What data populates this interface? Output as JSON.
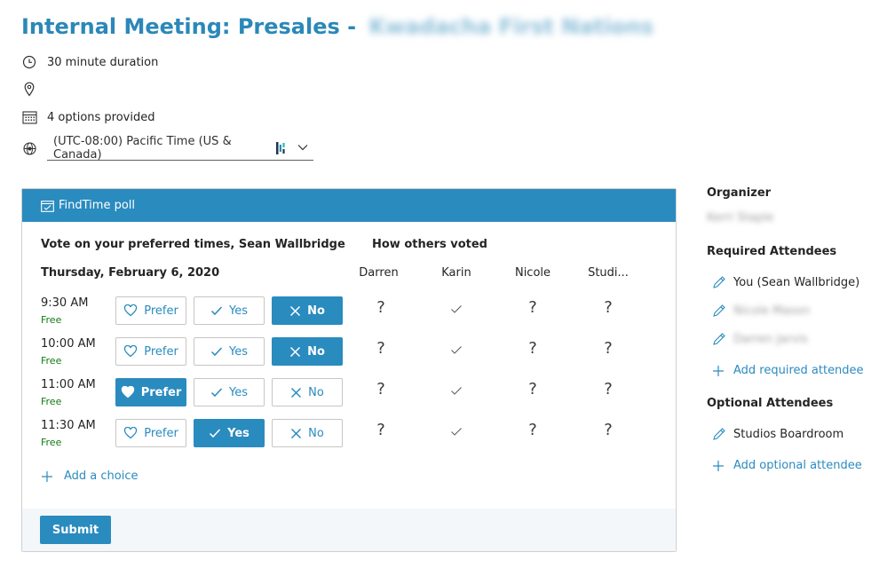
{
  "meeting": {
    "title": "Internal Meeting: Presales -",
    "title_redacted": "Kwadacha First Nations",
    "duration": "30 minute duration",
    "location": "",
    "options": "4 options provided",
    "timezone": "(UTC-08:00) Pacific Time (US & Canada)"
  },
  "poll": {
    "header": "FindTime poll",
    "vote_title": "Vote on your preferred times, Sean Wallbridge",
    "others_title": "How others voted",
    "date": "Thursday, February 6, 2020",
    "people": [
      "Darren",
      "Karin",
      "Nicole",
      "Studi..."
    ],
    "option_labels": {
      "prefer": "Prefer",
      "yes": "Yes",
      "no": "No"
    },
    "slots": [
      {
        "time": "9:30 AM",
        "status": "Free",
        "selected": "no",
        "others": [
          "?",
          "check",
          "?",
          "?"
        ]
      },
      {
        "time": "10:00 AM",
        "status": "Free",
        "selected": "no",
        "others": [
          "?",
          "check",
          "?",
          "?"
        ]
      },
      {
        "time": "11:00 AM",
        "status": "Free",
        "selected": "prefer",
        "others": [
          "?",
          "check",
          "?",
          "?"
        ]
      },
      {
        "time": "11:30 AM",
        "status": "Free",
        "selected": "yes",
        "others": [
          "?",
          "check",
          "?",
          "?"
        ]
      }
    ],
    "add_choice": "Add a choice",
    "submit": "Submit"
  },
  "sidebar": {
    "organizer_heading": "Organizer",
    "organizer_name": "Kerri Staple",
    "required_heading": "Required Attendees",
    "required": [
      "You (Sean Wallbridge)",
      "Nicole Mason",
      "Darren Jarvis"
    ],
    "add_required": "Add required attendee",
    "optional_heading": "Optional Attendees",
    "optional": [
      "Studios Boardroom"
    ],
    "add_optional": "Add optional attendee"
  },
  "colors": {
    "accent": "#2a8bbf",
    "title": "#2b88b8",
    "free": "#107c10"
  }
}
